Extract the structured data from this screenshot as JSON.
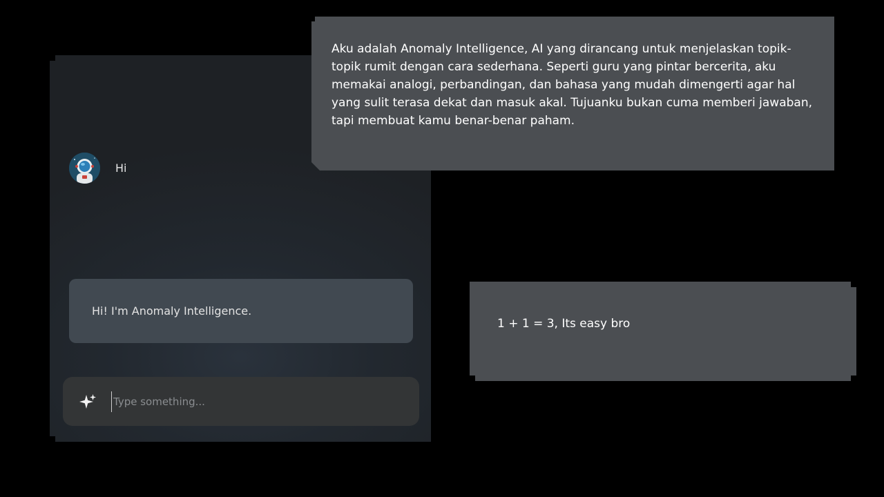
{
  "chat": {
    "user_message": "Hi",
    "bot_message": "Hi! I'm Anomaly Intelligence.",
    "input": {
      "placeholder": "Type something...",
      "value": "",
      "icon": "sparkle-icon"
    },
    "avatar_icon": "astronaut-avatar-icon"
  },
  "callouts": {
    "description": "Aku adalah Anomaly Intelligence, AI yang dirancang untuk menjelaskan topik-topik rumit dengan cara sederhana. Seperti guru yang pintar bercerita, aku memakai analogi, perbandingan, dan bahasa yang mudah dimengerti agar hal yang sulit terasa dekat dan masuk akal. Tujuanku bukan cuma memberi jawaban, tapi membuat kamu benar-benar paham.",
    "example": "1 + 1 = 3, Its easy bro"
  },
  "colors": {
    "background": "#000000",
    "panel": "#22282f",
    "bot_bubble": "#414951",
    "input_bar": "#333536",
    "callout": "#4b4e52"
  }
}
